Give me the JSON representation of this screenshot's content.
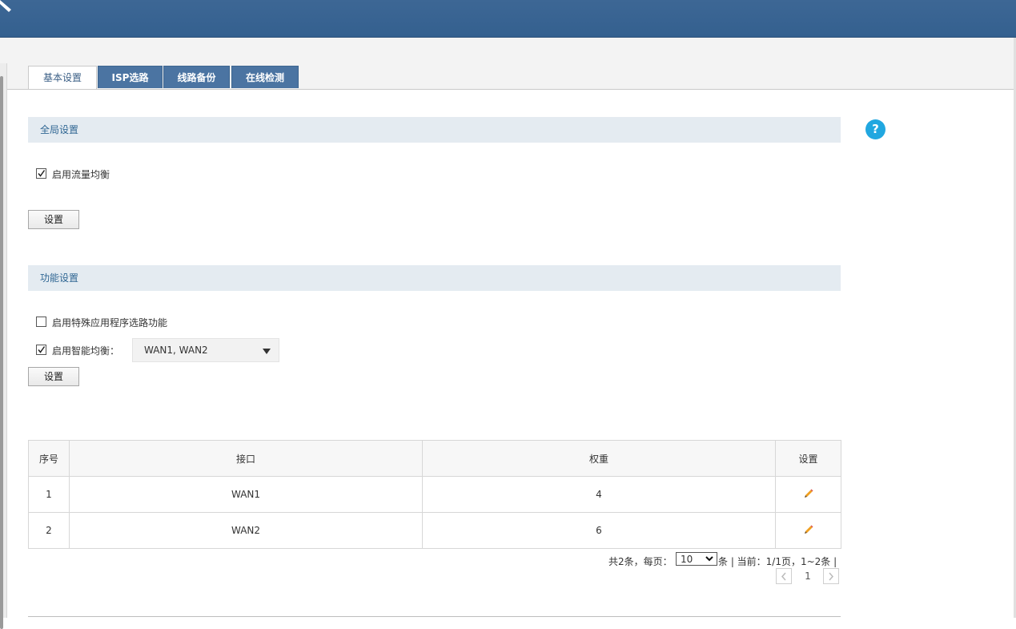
{
  "tabs": [
    {
      "label": "基本设置",
      "active": true
    },
    {
      "label": "ISP选路",
      "active": false
    },
    {
      "label": "线路备份",
      "active": false
    },
    {
      "label": "在线检测",
      "active": false
    }
  ],
  "global": {
    "title": "全局设置",
    "enable_lb": {
      "label": "启用流量均衡",
      "checked": true
    },
    "set_button": "设置"
  },
  "func": {
    "title": "功能设置",
    "special_app": {
      "label": "启用特殊应用程序选路功能",
      "checked": false
    },
    "smart_lb": {
      "label": "启用智能均衡：",
      "checked": true
    },
    "smart_lb_value": "WAN1, WAN2",
    "set_button": "设置"
  },
  "table": {
    "headers": [
      "序号",
      "接口",
      "权重",
      "设置"
    ],
    "rows": [
      {
        "index": "1",
        "interface": "WAN1",
        "weight": "4"
      },
      {
        "index": "2",
        "interface": "WAN2",
        "weight": "6"
      }
    ]
  },
  "pagination": {
    "total_label": "共2条，每页：",
    "per_page": "10",
    "status": "条 | 当前：1/1页，1~2条 |",
    "current_page": "1"
  },
  "colors": {
    "header_bar": "#3d6795",
    "tab_inactive": "#4b74a2",
    "section_bg": "#e4ebf1",
    "help_icon": "#21a7e0"
  },
  "icons": {
    "help": "?",
    "edit": "pencil-icon"
  }
}
